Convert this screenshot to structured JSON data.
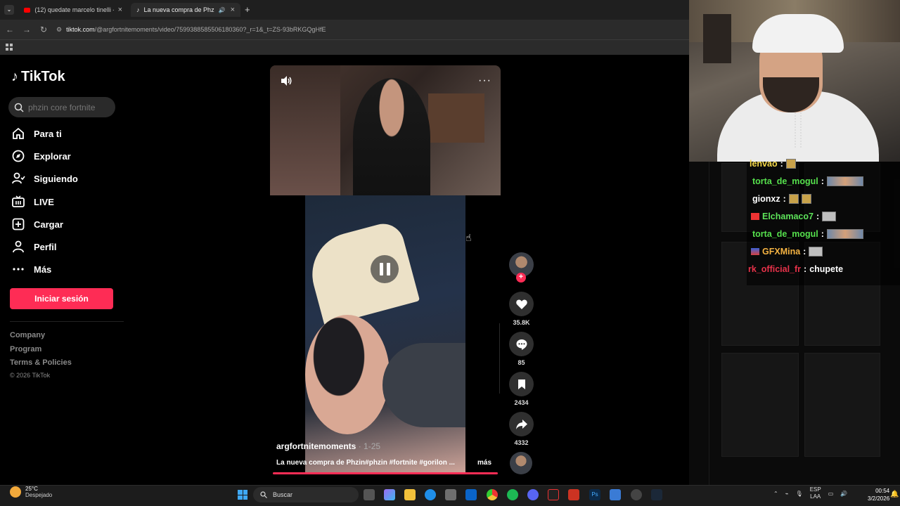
{
  "browser": {
    "tabs": [
      {
        "title": "(12) quedate marcelo tinelli - Yo",
        "active": false
      },
      {
        "title": "La nueva compra de Phzin",
        "active": true
      }
    ],
    "new_tab": "+",
    "url_host": "tiktok.com",
    "url_path": "/@argfortnitemoments/video/7599388585506180360?_r=1&_t=ZS-93bRKGQgHfE"
  },
  "sidebar": {
    "logo": "TikTok",
    "search_placeholder": "phzin core fortnite",
    "nav": [
      {
        "label": "Para ti",
        "icon": "home-icon"
      },
      {
        "label": "Explorar",
        "icon": "compass-icon"
      },
      {
        "label": "Siguiendo",
        "icon": "user-follow-icon"
      },
      {
        "label": "LIVE",
        "icon": "live-tv-icon"
      },
      {
        "label": "Cargar",
        "icon": "upload-icon"
      },
      {
        "label": "Perfil",
        "icon": "profile-icon"
      },
      {
        "label": "Más",
        "icon": "more-icon"
      }
    ],
    "login_label": "Iniciar sesión",
    "footer": [
      "Company",
      "Program",
      "Terms & Policies"
    ],
    "copyright": "© 2026 TikTok"
  },
  "video": {
    "author": "argfortnitemoments",
    "date": "· 1-25",
    "description": "La nueva compra de Phzin#phzin #fortnite #gorilon ...",
    "more_label": "más",
    "progress": 1.0,
    "more_menu": "···"
  },
  "actions": {
    "likes": "35.8K",
    "comments": "85",
    "saves": "2434",
    "shares": "4332",
    "follow": "+"
  },
  "chat": [
    {
      "user": "lenvao",
      "color": "#f5d94a",
      "badge": "",
      "emotes": [
        "tag"
      ]
    },
    {
      "user": "torta_de_mogul",
      "color": "#56e04d",
      "badge": "",
      "emotes": [
        "wide"
      ]
    },
    {
      "user": "gionxz",
      "color": "#ffffff",
      "badge": "",
      "emotes": [
        "tag",
        "tag"
      ]
    },
    {
      "user": "Elchamaco7",
      "color": "#5de35a",
      "badge": "red",
      "emotes": [
        "std"
      ]
    },
    {
      "user": "torta_de_mogul",
      "color": "#56e04d",
      "badge": "",
      "emotes": [
        "wide"
      ]
    },
    {
      "user": "GFXMina",
      "color": "#f5b342",
      "badge": "flag",
      "emotes": [
        "std"
      ]
    },
    {
      "user": "rk_official_fr",
      "color": "#e8324a",
      "badge": "",
      "message": "chupete"
    }
  ],
  "chat_colon": ":",
  "taskbar": {
    "temp": "25°C",
    "weather": "Despejado",
    "search": "Buscar",
    "lang1": "ESP",
    "lang2": "LAA",
    "time": "00:54",
    "date": "3/2/2026"
  },
  "colors": {
    "accent": "#fe2c55",
    "background": "#000000"
  }
}
